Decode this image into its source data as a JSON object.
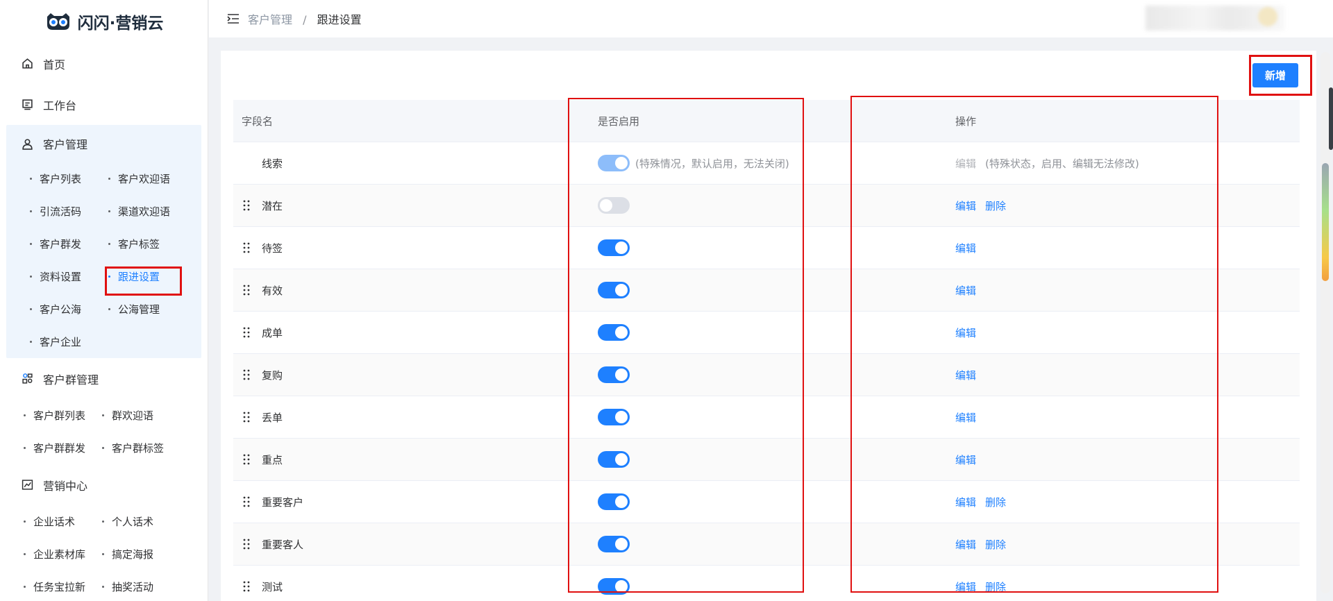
{
  "logo": {
    "text": "闪闪·营销云"
  },
  "sidebar": {
    "home": "首页",
    "workbench": "工作台",
    "customer_mgmt": {
      "label": "客户管理",
      "items": [
        "客户列表",
        "客户欢迎语",
        "引流活码",
        "渠道欢迎语",
        "客户群发",
        "客户标签",
        "资料设置",
        "跟进设置",
        "客户公海",
        "公海管理"
      ],
      "single": "客户企业",
      "active": "跟进设置"
    },
    "group_mgmt": {
      "label": "客户群管理",
      "items": [
        "客户群列表",
        "群欢迎语",
        "客户群群发",
        "客户群标签"
      ]
    },
    "marketing": {
      "label": "营销中心",
      "items": [
        "企业话术",
        "个人话术",
        "企业素材库",
        "搞定海报",
        "任务宝拉新",
        "抽奖活动"
      ]
    }
  },
  "breadcrumb": {
    "parent": "客户管理",
    "separator": "/",
    "current": "跟进设置"
  },
  "toolbar": {
    "add_label": "新增"
  },
  "table": {
    "headers": {
      "field": "字段名",
      "enabled": "是否启用",
      "actions": "操作"
    },
    "rows": [
      {
        "name": "线索",
        "enabled": true,
        "locked": true,
        "enable_note": "(特殊情况，默认启用，无法关闭)",
        "edit": "编辑",
        "action_note": "(特殊状态，启用、编辑无法修改)"
      },
      {
        "name": "潜在",
        "enabled": false,
        "edit": "编辑",
        "delete": "删除"
      },
      {
        "name": "待签",
        "enabled": true,
        "edit": "编辑"
      },
      {
        "name": "有效",
        "enabled": true,
        "edit": "编辑"
      },
      {
        "name": "成单",
        "enabled": true,
        "edit": "编辑"
      },
      {
        "name": "复购",
        "enabled": true,
        "edit": "编辑"
      },
      {
        "name": "丢单",
        "enabled": true,
        "edit": "编辑"
      },
      {
        "name": "重点",
        "enabled": true,
        "edit": "编辑"
      },
      {
        "name": "重要客户",
        "enabled": true,
        "edit": "编辑",
        "delete": "删除"
      },
      {
        "name": "重要客人",
        "enabled": true,
        "edit": "编辑",
        "delete": "删除"
      },
      {
        "name": "测试",
        "enabled": true,
        "edit": "编辑",
        "delete": "删除"
      }
    ]
  },
  "colors": {
    "primary": "#1e80ff",
    "highlight": "#e01010"
  }
}
